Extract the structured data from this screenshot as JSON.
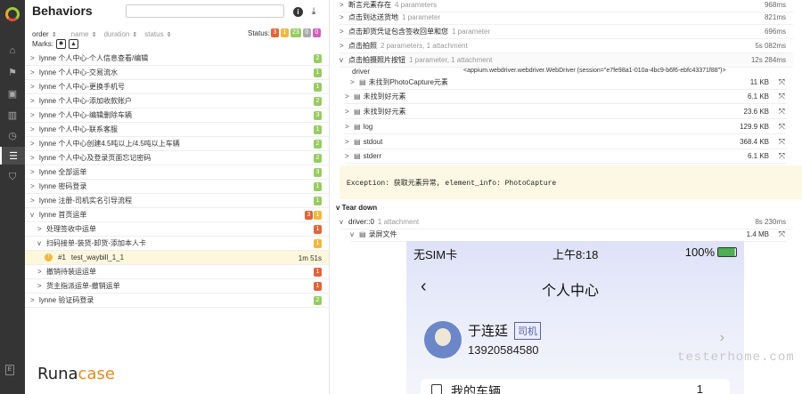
{
  "sidebar": {
    "items": [
      {
        "name": "home-icon",
        "glyph": "⌂"
      },
      {
        "name": "flag-icon",
        "glyph": "⚑"
      },
      {
        "name": "briefcase-icon",
        "glyph": "▣"
      },
      {
        "name": "chart-icon",
        "glyph": "▥"
      },
      {
        "name": "clock-icon",
        "glyph": "◷"
      },
      {
        "name": "list-icon",
        "glyph": "☰"
      },
      {
        "name": "tag-icon",
        "glyph": "⛉"
      }
    ],
    "collapse_glyph": "E"
  },
  "left": {
    "title": "Behaviors",
    "sort": {
      "order": "order",
      "name": "name",
      "duration": "duration",
      "status": "status"
    },
    "status_label": "Status:",
    "status_counts": [
      "3",
      "1",
      "23",
      "0",
      "0"
    ],
    "marks_label": "Marks:",
    "tree": [
      {
        "label": "lynne 个人中心-个人信息查看/编辑",
        "chev": ">",
        "counts": [
          {
            "v": "2",
            "c": "pass"
          }
        ]
      },
      {
        "label": "lynne 个人中心-交易流水",
        "chev": ">",
        "counts": [
          {
            "v": "1",
            "c": "pass"
          }
        ]
      },
      {
        "label": "lynne 个人中心-更换手机号",
        "chev": ">",
        "counts": [
          {
            "v": "1",
            "c": "pass"
          }
        ]
      },
      {
        "label": "lynne 个人中心-添加收款账户",
        "chev": ">",
        "counts": [
          {
            "v": "2",
            "c": "pass"
          }
        ]
      },
      {
        "label": "lynne 个人中心-编辑删除车辆",
        "chev": ">",
        "counts": [
          {
            "v": "3",
            "c": "pass"
          }
        ]
      },
      {
        "label": "lynne 个人中心-联系客服",
        "chev": ">",
        "counts": [
          {
            "v": "1",
            "c": "pass"
          }
        ]
      },
      {
        "label": "lynne 个人中心创建4.5吨以上/4.5吨以上车辆",
        "chev": ">",
        "counts": [
          {
            "v": "2",
            "c": "pass"
          }
        ]
      },
      {
        "label": "lynne 个人中心及登录页面忘记密码",
        "chev": ">",
        "counts": [
          {
            "v": "2",
            "c": "pass"
          }
        ]
      },
      {
        "label": "lynne 全部运单",
        "chev": ">",
        "counts": [
          {
            "v": "3",
            "c": "pass"
          }
        ]
      },
      {
        "label": "lynne 密码登录",
        "chev": ">",
        "counts": [
          {
            "v": "1",
            "c": "pass"
          }
        ]
      },
      {
        "label": "lynne 注册-司机实名引导流程",
        "chev": ">",
        "counts": [
          {
            "v": "1",
            "c": "pass"
          }
        ]
      },
      {
        "label": "lynne 首页运单",
        "chev": "v",
        "counts": [
          {
            "v": "3",
            "c": "fail"
          },
          {
            "v": "1",
            "c": "broken"
          }
        ]
      },
      {
        "label": "处理签收中运单",
        "chev": ">",
        "counts": [
          {
            "v": "1",
            "c": "fail"
          }
        ],
        "indent": 1
      },
      {
        "label": "扫码接单-装货-卸货-添加本人卡",
        "chev": "v",
        "counts": [
          {
            "v": "1",
            "c": "broken"
          }
        ],
        "indent": 1
      },
      {
        "label": "test_waybill_1_1",
        "num": "#1",
        "duration": "1m 51s",
        "selected": true,
        "indent": 2
      },
      {
        "label": "撤销待装运运单",
        "chev": ">",
        "counts": [
          {
            "v": "1",
            "c": "fail"
          }
        ],
        "indent": 1
      },
      {
        "label": "货主指派运单-撤销运单",
        "chev": ">",
        "counts": [
          {
            "v": "1",
            "c": "fail"
          }
        ],
        "indent": 1
      },
      {
        "label": "lynne 验证码登录",
        "chev": ">",
        "counts": [
          {
            "v": "2",
            "c": "pass"
          }
        ]
      }
    ],
    "brand_a": "Runa",
    "brand_b": "case"
  },
  "right": {
    "steps": [
      {
        "name": "断言元素存在",
        "meta": "4 parameters",
        "time": "968ms"
      },
      {
        "name": "点击到达送货地",
        "meta": "1 parameter",
        "time": "821ms"
      },
      {
        "name": "点击卸货凭证包含签收回单和您",
        "meta": "1 parameter",
        "time": "696ms"
      },
      {
        "name": "点击拍照",
        "meta": "2 parameters, 1 attachment",
        "time": "5s 082ms"
      },
      {
        "name": "点击拍摄照片按钮",
        "meta": "1 parameter, 1 attachment",
        "time": "12s 284ms",
        "expanded": true
      }
    ],
    "param_key": "driver",
    "param_value": "<appium.webdriver.webdriver.WebDriver (session=\"e7fe98a1-010a-4bc9-b6f6-ebfc43371f88\")>",
    "attachments": [
      {
        "name": "未找到PhotoCapture元素",
        "size": "11 KB",
        "indent": 1
      },
      {
        "name": "未找到好元素",
        "size": "6.1 KB"
      },
      {
        "name": "未找到好元素",
        "size": "23.6 KB"
      },
      {
        "name": "log",
        "size": "129.9 KB"
      },
      {
        "name": "stdout",
        "size": "368.4 KB"
      },
      {
        "name": "stderr",
        "size": "6.1 KB"
      }
    ],
    "exception": "Exception: 获取元素异常, element_info: PhotoCapture",
    "teardown": "Tear down",
    "driver_row": {
      "name": "driver::0",
      "meta": "1 attachment",
      "time": "8s 230ms"
    },
    "video": {
      "name": "录屏文件",
      "size": "1.4 MB"
    },
    "phone": {
      "carrier": "无SIM卡",
      "time": "上午8:18",
      "battery": "100%",
      "title": "个人中心",
      "user_name": "于连廷",
      "role": "司机",
      "phone": "13920584580",
      "menu_label": "我的车辆",
      "menu_count": "1"
    },
    "watermark": "testerhome.com"
  }
}
